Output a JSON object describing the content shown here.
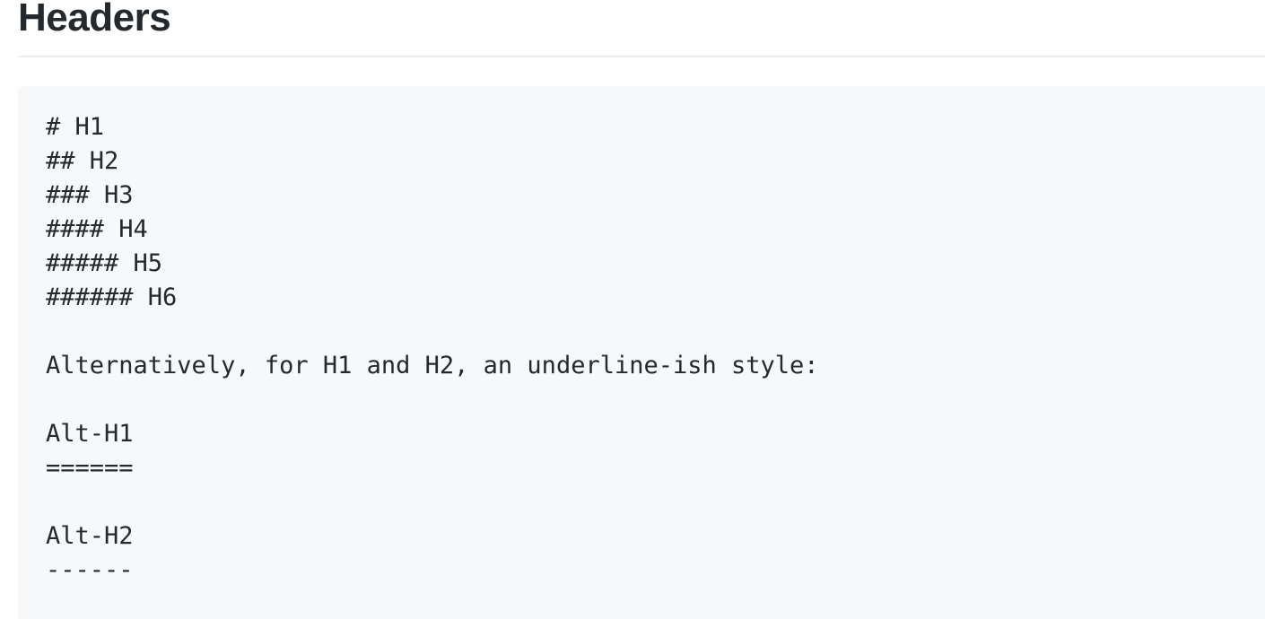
{
  "section": {
    "title": "Headers"
  },
  "code": {
    "lines": [
      "# H1",
      "## H2",
      "### H3",
      "#### H4",
      "##### H5",
      "###### H6",
      "",
      "Alternatively, for H1 and H2, an underline-ish style:",
      "",
      "Alt-H1",
      "======",
      "",
      "Alt-H2",
      "------"
    ]
  }
}
